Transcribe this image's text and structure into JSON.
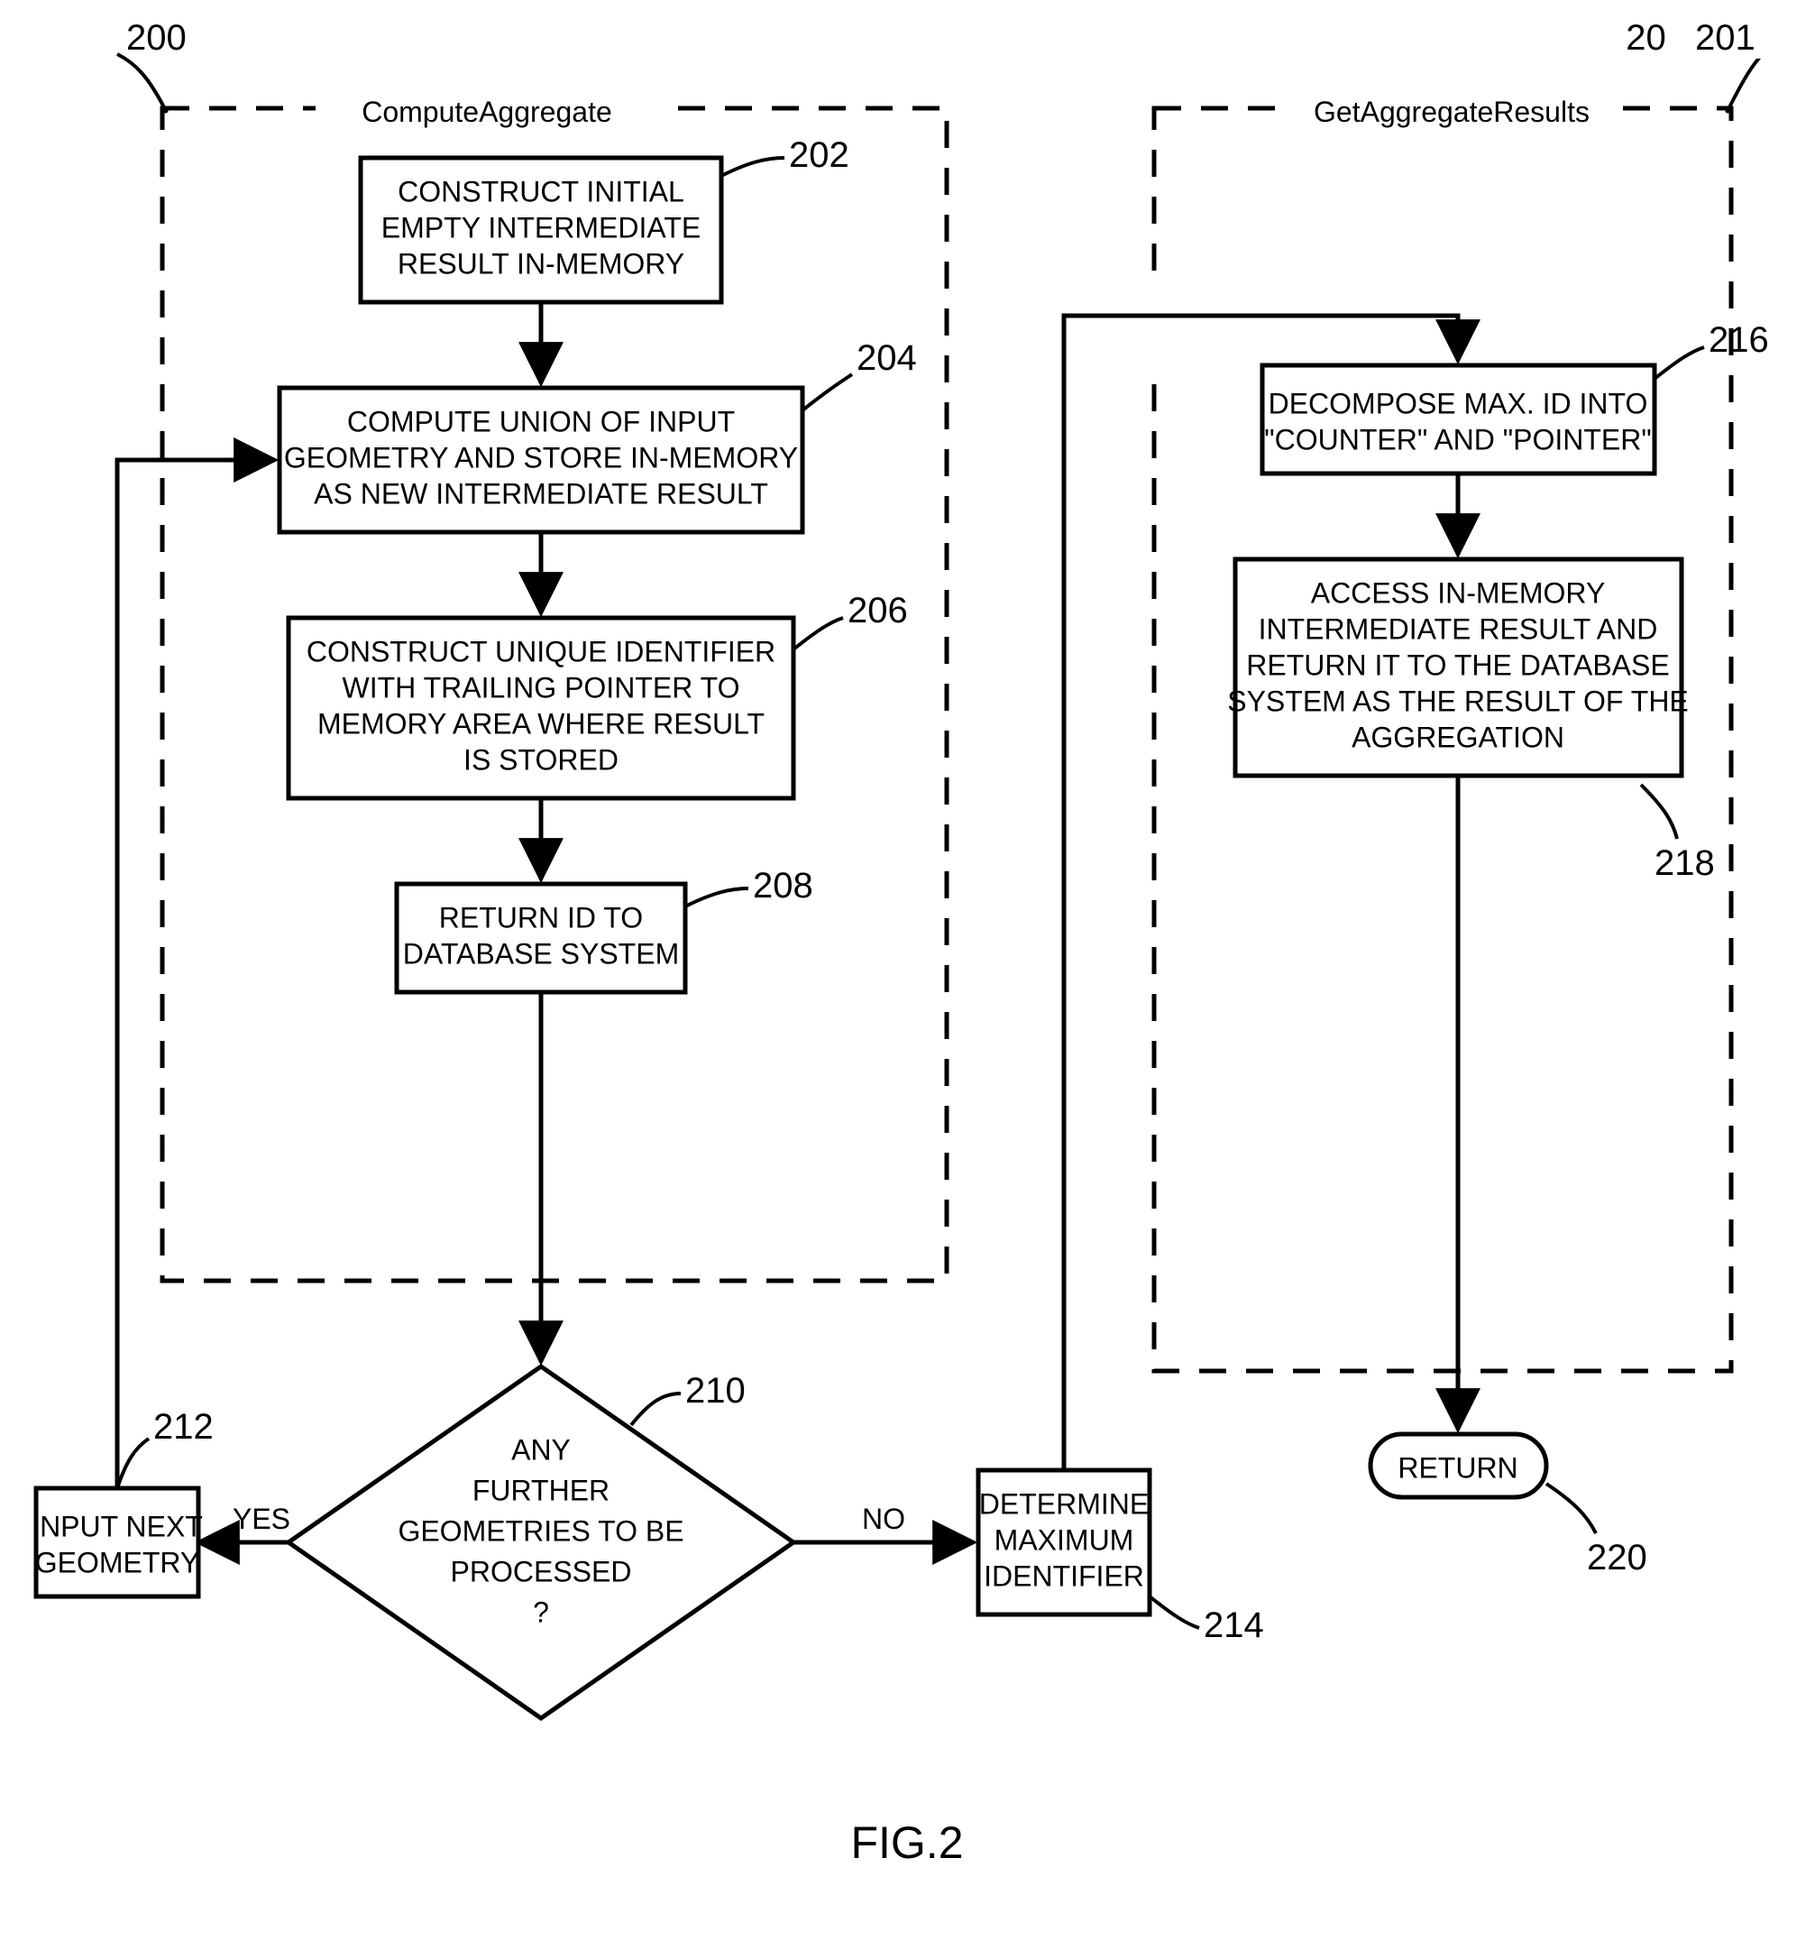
{
  "figure_label": "FIG.2",
  "refs": {
    "r200": "200",
    "r201": "201",
    "r202": "202",
    "r204": "204",
    "r206": "206",
    "r208": "208",
    "r210": "210",
    "r212": "212",
    "r214": "214",
    "r216": "216",
    "r218": "218",
    "r220": "220"
  },
  "titles": {
    "left": "ComputeAggregate",
    "right": "GetAggregateResults"
  },
  "boxes": {
    "b202": [
      "CONSTRUCT INITIAL",
      "EMPTY INTERMEDIATE",
      "RESULT IN-MEMORY"
    ],
    "b204": [
      "COMPUTE UNION OF INPUT",
      "GEOMETRY AND STORE IN-MEMORY",
      "AS NEW INTERMEDIATE RESULT"
    ],
    "b206": [
      "CONSTRUCT UNIQUE IDENTIFIER",
      "WITH TRAILING POINTER TO",
      "MEMORY AREA WHERE RESULT",
      "IS STORED"
    ],
    "b208": [
      "RETURN ID TO",
      "DATABASE SYSTEM"
    ],
    "b216": [
      "DECOMPOSE MAX. ID INTO",
      "\"COUNTER\" AND \"POINTER\""
    ],
    "b218": [
      "ACCESS IN-MEMORY",
      "INTERMEDIATE RESULT AND",
      "RETURN IT TO THE DATABASE",
      "SYSTEM AS THE RESULT OF THE",
      "AGGREGATION"
    ],
    "b212": [
      "INPUT NEXT",
      "GEOMETRY"
    ],
    "b214": [
      "DETERMINE",
      "MAXIMUM",
      "IDENTIFIER"
    ]
  },
  "decision": {
    "d210": [
      "ANY",
      "FURTHER",
      "GEOMETRIES TO BE",
      "PROCESSED",
      "?"
    ]
  },
  "terminal": {
    "t220": "RETURN"
  },
  "edges": {
    "yes": "YES",
    "no": "NO"
  }
}
